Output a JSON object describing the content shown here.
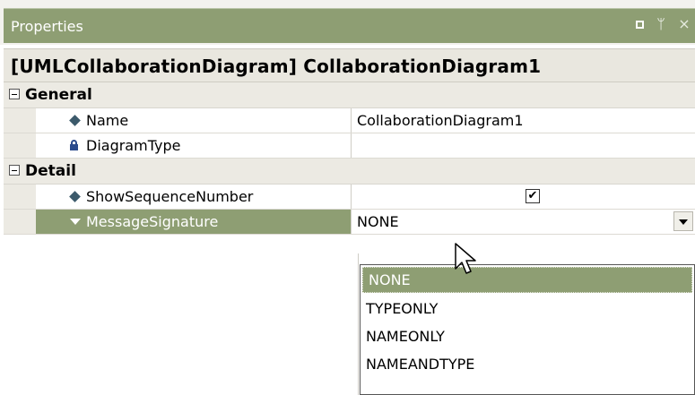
{
  "panel": {
    "title": "Properties",
    "controls": [
      "maximize",
      "pin",
      "close"
    ],
    "close_glyph": "×",
    "pin_glyph": "ᛘ"
  },
  "object_heading": "[UMLCollaborationDiagram] CollaborationDiagram1",
  "categories": [
    {
      "label": "General",
      "expanded": true,
      "properties": [
        {
          "name": "Name",
          "icon": "diamond-icon",
          "value": "CollaborationDiagram1"
        },
        {
          "name": "DiagramType",
          "icon": "lock-icon",
          "value": ""
        }
      ]
    },
    {
      "label": "Detail",
      "expanded": true,
      "properties": [
        {
          "name": "ShowSequenceNumber",
          "icon": "diamond-icon",
          "value": true
        },
        {
          "name": "MessageSignature",
          "icon": "triangle-down-icon",
          "value": "NONE",
          "selected": true
        }
      ]
    }
  ],
  "checkbox_glyph": "✔",
  "dropdown": {
    "open": true,
    "options": [
      "NONE",
      "TYPEONLY",
      "NAMEONLY",
      "NAMEANDTYPE"
    ],
    "selected": "NONE"
  },
  "colors": {
    "accent": "#8e9e73",
    "category_bg": "#eceae3"
  }
}
